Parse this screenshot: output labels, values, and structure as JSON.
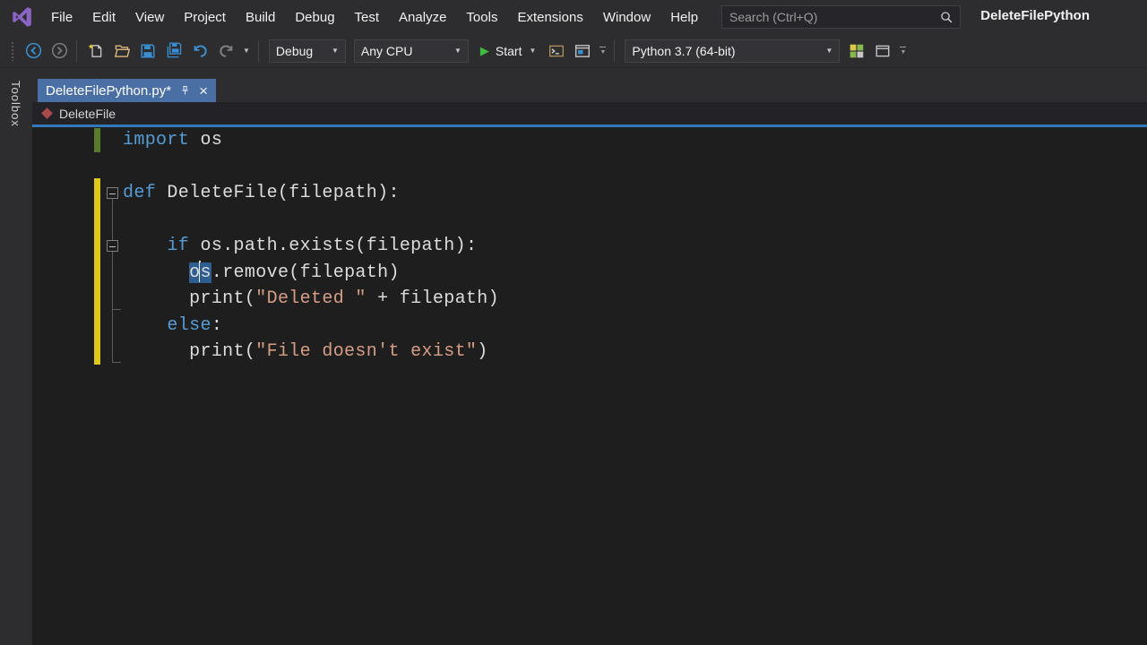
{
  "window": {
    "title": "DeleteFilePython"
  },
  "menu": {
    "items": [
      "File",
      "Edit",
      "View",
      "Project",
      "Build",
      "Debug",
      "Test",
      "Analyze",
      "Tools",
      "Extensions",
      "Window",
      "Help"
    ]
  },
  "search": {
    "placeholder": "Search (Ctrl+Q)"
  },
  "toolbar": {
    "debug_target": "Debug",
    "platform": "Any CPU",
    "start_label": "Start",
    "environment": "Python 3.7 (64-bit)"
  },
  "tab": {
    "title": "DeleteFilePython.py*"
  },
  "navbar": {
    "member": "DeleteFile"
  },
  "left_rail": {
    "toolbox_label": "Toolbox"
  },
  "glyphs": {
    "chevron_down": "▼",
    "close": "×",
    "play": "▶"
  },
  "colors": {
    "chrome": "#2d2d30",
    "editor_bg": "#1e1e1e",
    "tab_active": "#4a6fa5",
    "accent_line": "#3279bd",
    "keyword": "#569cd6",
    "string": "#d69d85",
    "code_text": "#dcdcdc",
    "change_saved": "#577a2b",
    "change_unsaved": "#dfc81e",
    "selection": "#2e5e8f",
    "start_green": "#3dbb3d",
    "logo_purple": "#8a63c4"
  },
  "editor": {
    "code_lines": [
      {
        "tokens": [
          {
            "t": "import",
            "c": "kw"
          },
          {
            "t": " os"
          }
        ]
      },
      {
        "tokens": []
      },
      {
        "tokens": [
          {
            "t": "def",
            "c": "kw"
          },
          {
            "t": " DeleteFile(filepath):"
          }
        ]
      },
      {
        "tokens": []
      },
      {
        "tokens": [
          {
            "t": "    "
          },
          {
            "t": "if",
            "c": "kw"
          },
          {
            "t": " os.path.exists(filepath):"
          }
        ]
      },
      {
        "tokens": [
          {
            "t": "      "
          },
          {
            "t": "o",
            "c": "sel"
          },
          {
            "c": "caret"
          },
          {
            "t": "s",
            "c": "sel"
          },
          {
            "t": ".remove(filepath)"
          }
        ]
      },
      {
        "tokens": [
          {
            "t": "      print("
          },
          {
            "t": "\"Deleted \"",
            "c": "str"
          },
          {
            "t": " + filepath)"
          }
        ]
      },
      {
        "tokens": [
          {
            "t": "    "
          },
          {
            "t": "else",
            "c": "kw"
          },
          {
            "t": ":"
          }
        ]
      },
      {
        "tokens": [
          {
            "t": "      print("
          },
          {
            "t": "\"File doesn't exist\"",
            "c": "str"
          },
          {
            "t": ")"
          }
        ]
      }
    ]
  }
}
